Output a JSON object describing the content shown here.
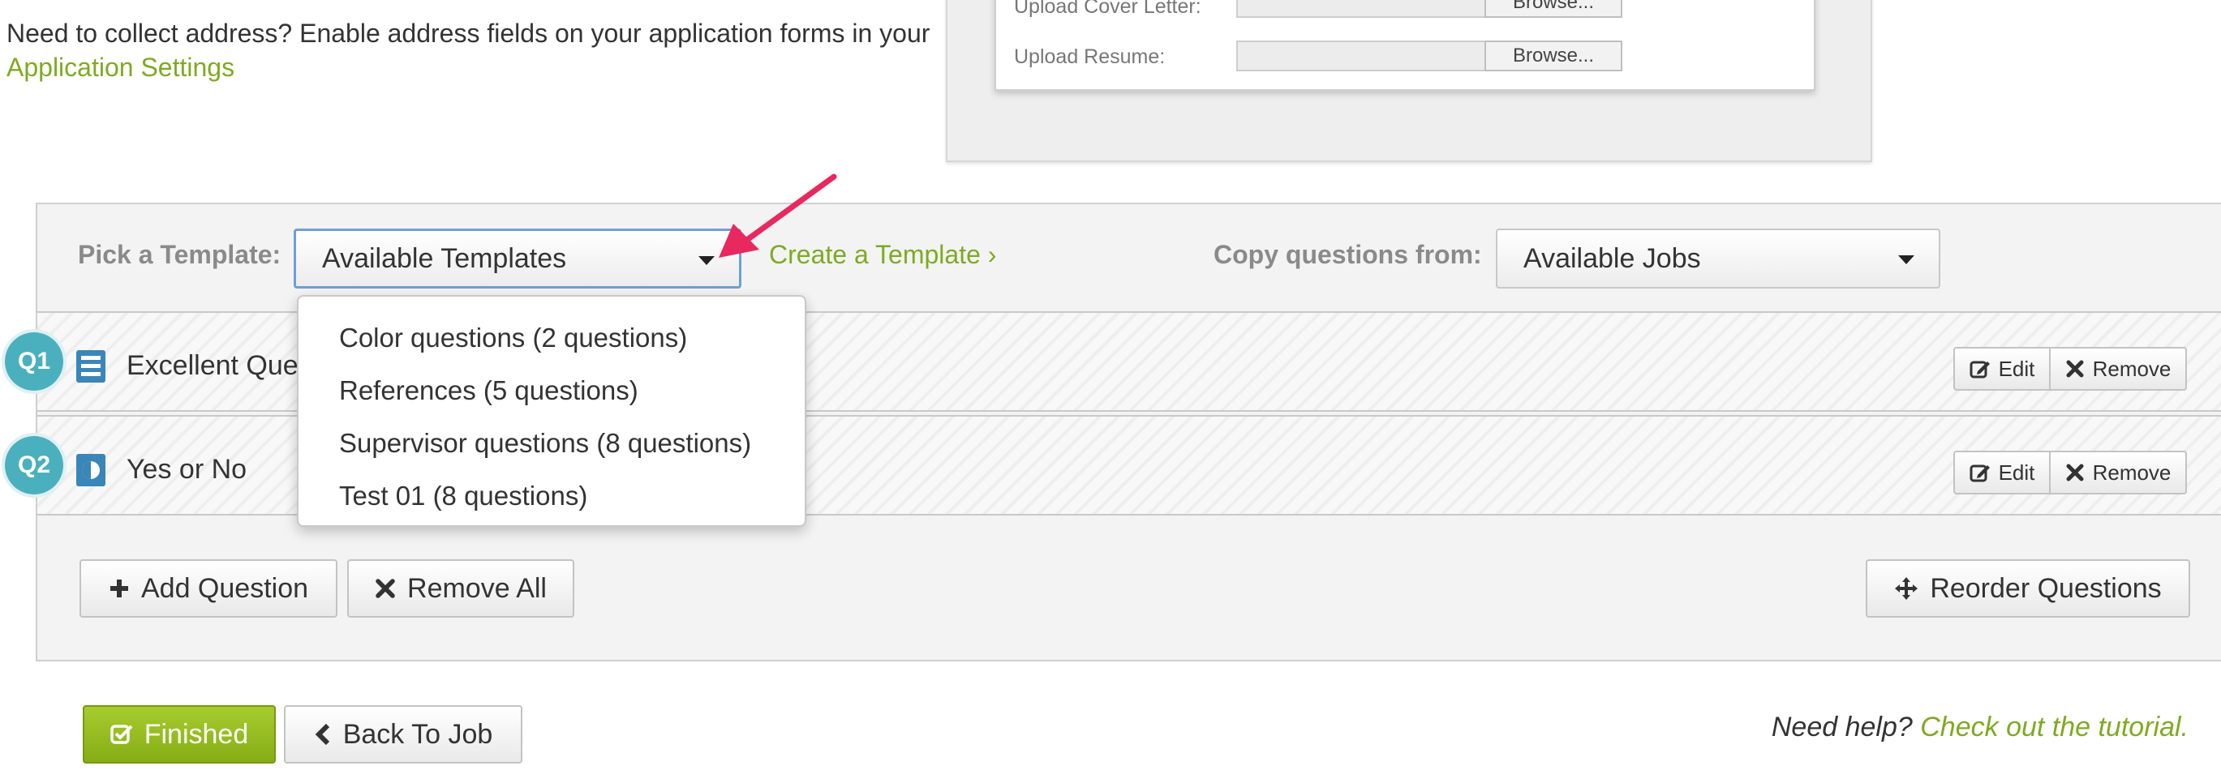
{
  "note": {
    "text": "Need to collect address? Enable address fields on your application forms in your",
    "link": "Application Settings"
  },
  "preview": {
    "rows": [
      {
        "label": "Upload Cover Letter:",
        "button": "Browse..."
      },
      {
        "label": "Upload Resume:",
        "button": "Browse..."
      }
    ]
  },
  "template_bar": {
    "pick_label": "Pick a Template:",
    "template_select": "Available Templates",
    "create_link": "Create a Template ›",
    "copy_label": "Copy questions from:",
    "jobs_select": "Available Jobs"
  },
  "template_options": [
    "Color questions (2 questions)",
    "References (5 questions)",
    "Supervisor questions (8 questions)",
    "Test 01 (8 questions)"
  ],
  "questions": [
    {
      "badge": "Q1",
      "text": "Excellent Que",
      "type_icon": "list-icon",
      "edit": "Edit",
      "remove": "Remove"
    },
    {
      "badge": "Q2",
      "text": "Yes or No",
      "type_icon": "half-circle-icon",
      "edit": "Edit",
      "remove": "Remove"
    }
  ],
  "actions": {
    "add_question": "Add Question",
    "remove_all": "Remove All",
    "reorder": "Reorder Questions"
  },
  "footer": {
    "finished": "Finished",
    "back": "Back To Job",
    "help_text": "Need help?",
    "help_link": "Check out the tutorial."
  },
  "colors": {
    "accent_green": "#7faa21",
    "badge_teal": "#4bb0bd",
    "arrow_pink": "#e8285f",
    "finished_green": "#96bd22"
  }
}
